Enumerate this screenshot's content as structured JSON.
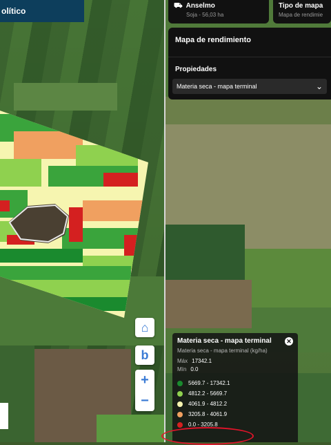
{
  "left": {
    "top_tab": "olítico",
    "controls": {
      "home_icon": "⌂",
      "bing_icon": "b",
      "zoom_in": "+",
      "zoom_out": "−"
    }
  },
  "right": {
    "field_card": {
      "title": "Anselmo",
      "subtitle": "Soja - 56,03 ha"
    },
    "map_type_card": {
      "title": "Tipo de mapa",
      "subtitle": "Mapa de rendimie"
    },
    "yield_panel": {
      "title": "Mapa de rendimiento",
      "properties_label": "Propiedades",
      "selected_property": "Materia seca - mapa terminal",
      "chevron_icon": "⌄"
    },
    "legend": {
      "title": "Materia seca - mapa terminal",
      "subtitle": "Materia seca - mapa terminal (kg/ha)",
      "max_label": "Máx",
      "max_value": "17342.1",
      "min_label": "Mín",
      "min_value": "0.0",
      "close_icon": "✕",
      "items": [
        {
          "label": "5669.7 - 17342.1",
          "color": "#1a8a2e"
        },
        {
          "label": "4812.2 - 5669.7",
          "color": "#8fd14f"
        },
        {
          "label": "4061.9 - 4812.2",
          "color": "#f6f5b0"
        },
        {
          "label": "3205.8 - 4061.9",
          "color": "#f0a060"
        },
        {
          "label": "0.0 - 3205.8",
          "color": "#d42020"
        }
      ]
    }
  }
}
